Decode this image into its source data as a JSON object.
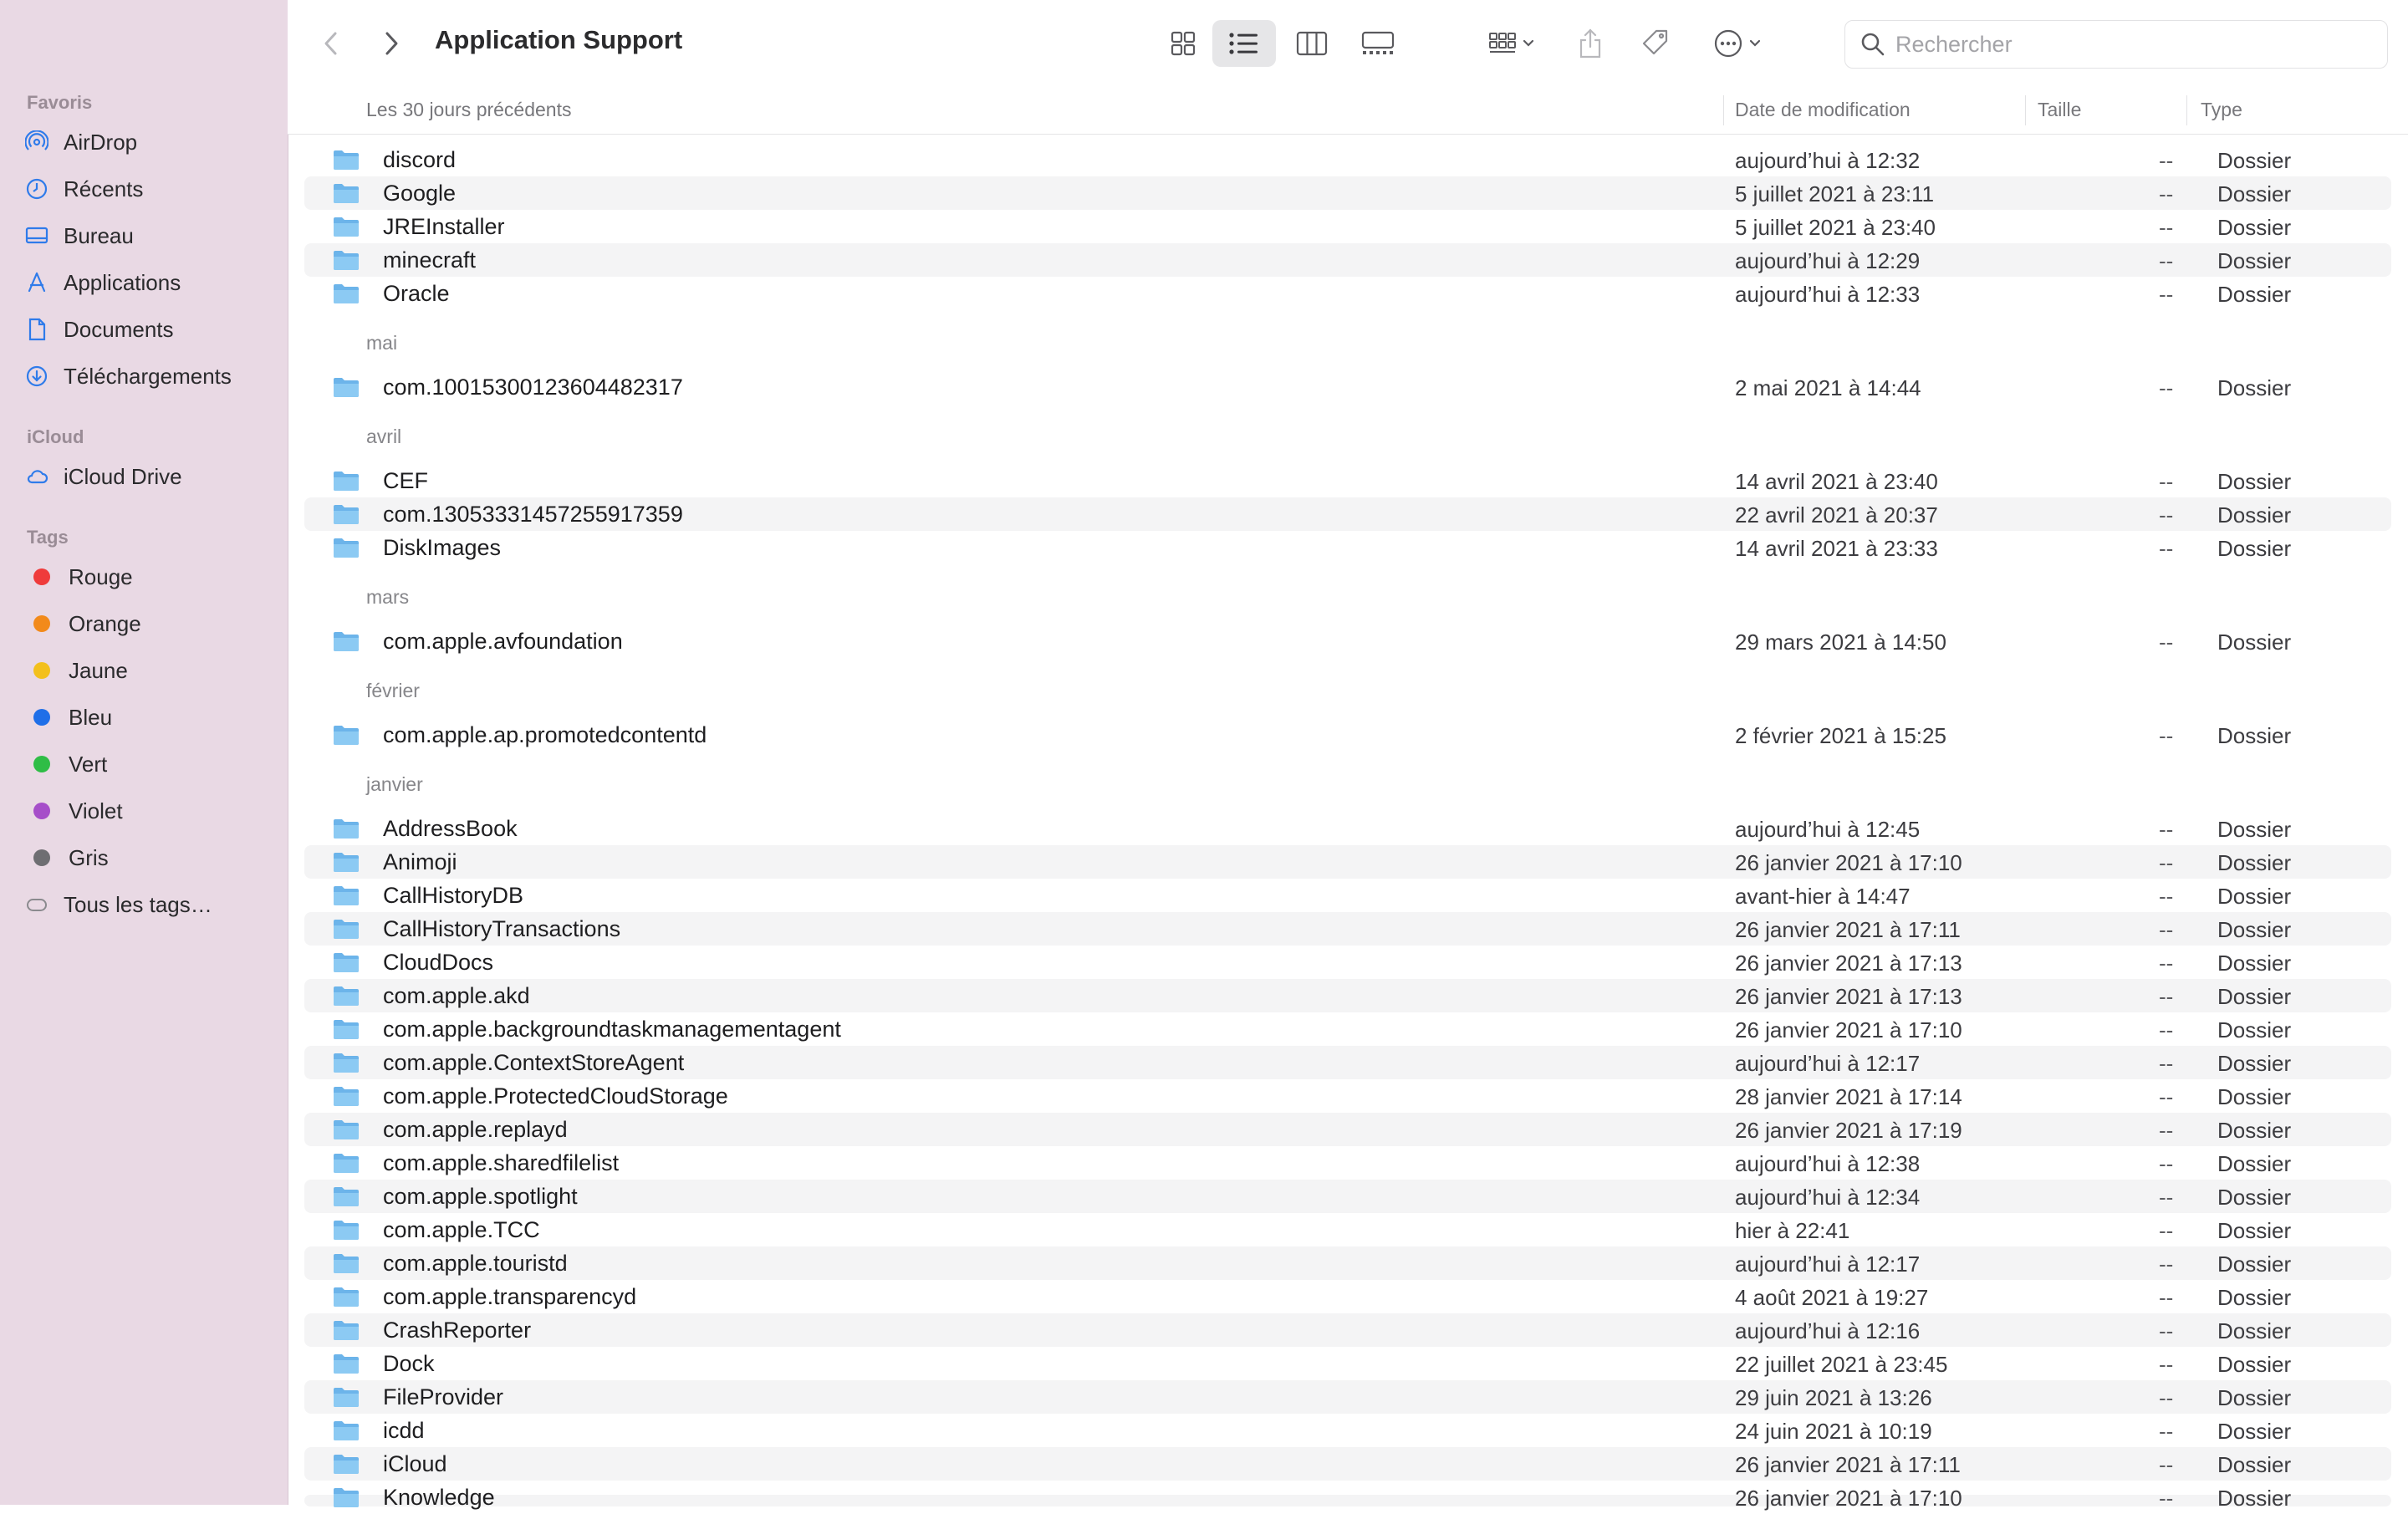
{
  "window": {
    "title": "Application Support"
  },
  "sidebar": {
    "favoris_label": "Favoris",
    "favoris": [
      {
        "label": "AirDrop",
        "icon": "airdrop-icon"
      },
      {
        "label": "Récents",
        "icon": "clock-icon"
      },
      {
        "label": "Bureau",
        "icon": "desktop-icon"
      },
      {
        "label": "Applications",
        "icon": "applications-icon"
      },
      {
        "label": "Documents",
        "icon": "document-icon"
      },
      {
        "label": "Téléchargements",
        "icon": "download-icon"
      }
    ],
    "icloud_label": "iCloud",
    "icloud": [
      {
        "label": "iCloud Drive",
        "icon": "cloud-icon"
      }
    ],
    "tags_label": "Tags",
    "tags": [
      {
        "label": "Rouge",
        "color": "#ef3b3b"
      },
      {
        "label": "Orange",
        "color": "#f28a1b"
      },
      {
        "label": "Jaune",
        "color": "#f3c01c"
      },
      {
        "label": "Bleu",
        "color": "#1f6fe8"
      },
      {
        "label": "Vert",
        "color": "#2fbd46"
      },
      {
        "label": "Violet",
        "color": "#a64ec9"
      },
      {
        "label": "Gris",
        "color": "#6e6e72"
      }
    ],
    "all_tags": "Tous les tags…"
  },
  "toolbar": {
    "search_placeholder": "Rechercher"
  },
  "columns": {
    "name": "Les 30 jours précédents",
    "date": "Date de modification",
    "size": "Taille",
    "type": "Type"
  },
  "groups": [
    {
      "label": "",
      "rows": [
        {
          "name": "discord",
          "date": "aujourd’hui à 12:32",
          "size": "--",
          "type": "Dossier"
        },
        {
          "name": "Google",
          "date": "5 juillet 2021 à 23:11",
          "size": "--",
          "type": "Dossier"
        },
        {
          "name": "JREInstaller",
          "date": "5 juillet 2021 à 23:40",
          "size": "--",
          "type": "Dossier"
        },
        {
          "name": "minecraft",
          "date": "aujourd’hui à 12:29",
          "size": "--",
          "type": "Dossier"
        },
        {
          "name": "Oracle",
          "date": "aujourd’hui à 12:33",
          "size": "--",
          "type": "Dossier"
        }
      ]
    },
    {
      "label": "mai",
      "rows": [
        {
          "name": "com.10015300123604482317",
          "date": "2 mai 2021 à 14:44",
          "size": "--",
          "type": "Dossier"
        }
      ]
    },
    {
      "label": "avril",
      "rows": [
        {
          "name": "CEF",
          "date": "14 avril 2021 à 23:40",
          "size": "--",
          "type": "Dossier"
        },
        {
          "name": "com.13053331457255917359",
          "date": "22 avril 2021 à 20:37",
          "size": "--",
          "type": "Dossier"
        },
        {
          "name": "DiskImages",
          "date": "14 avril 2021 à 23:33",
          "size": "--",
          "type": "Dossier"
        }
      ]
    },
    {
      "label": "mars",
      "rows": [
        {
          "name": "com.apple.avfoundation",
          "date": "29 mars 2021 à 14:50",
          "size": "--",
          "type": "Dossier"
        }
      ]
    },
    {
      "label": "février",
      "rows": [
        {
          "name": "com.apple.ap.promotedcontentd",
          "date": "2 février 2021 à 15:25",
          "size": "--",
          "type": "Dossier"
        }
      ]
    },
    {
      "label": "janvier",
      "rows": [
        {
          "name": "AddressBook",
          "date": "aujourd’hui à 12:45",
          "size": "--",
          "type": "Dossier"
        },
        {
          "name": "Animoji",
          "date": "26 janvier 2021 à 17:10",
          "size": "--",
          "type": "Dossier"
        },
        {
          "name": "CallHistoryDB",
          "date": "avant-hier à 14:47",
          "size": "--",
          "type": "Dossier"
        },
        {
          "name": "CallHistoryTransactions",
          "date": "26 janvier 2021 à 17:11",
          "size": "--",
          "type": "Dossier"
        },
        {
          "name": "CloudDocs",
          "date": "26 janvier 2021 à 17:13",
          "size": "--",
          "type": "Dossier"
        },
        {
          "name": "com.apple.akd",
          "date": "26 janvier 2021 à 17:13",
          "size": "--",
          "type": "Dossier"
        },
        {
          "name": "com.apple.backgroundtaskmanagementagent",
          "date": "26 janvier 2021 à 17:10",
          "size": "--",
          "type": "Dossier"
        },
        {
          "name": "com.apple.ContextStoreAgent",
          "date": "aujourd’hui à 12:17",
          "size": "--",
          "type": "Dossier"
        },
        {
          "name": "com.apple.ProtectedCloudStorage",
          "date": "28 janvier 2021 à 17:14",
          "size": "--",
          "type": "Dossier"
        },
        {
          "name": "com.apple.replayd",
          "date": "26 janvier 2021 à 17:19",
          "size": "--",
          "type": "Dossier"
        },
        {
          "name": "com.apple.sharedfilelist",
          "date": "aujourd’hui à 12:38",
          "size": "--",
          "type": "Dossier"
        },
        {
          "name": "com.apple.spotlight",
          "date": "aujourd’hui à 12:34",
          "size": "--",
          "type": "Dossier"
        },
        {
          "name": "com.apple.TCC",
          "date": "hier à 22:41",
          "size": "--",
          "type": "Dossier"
        },
        {
          "name": "com.apple.touristd",
          "date": "aujourd’hui à 12:17",
          "size": "--",
          "type": "Dossier"
        },
        {
          "name": "com.apple.transparencyd",
          "date": "4 août 2021 à 19:27",
          "size": "--",
          "type": "Dossier"
        },
        {
          "name": "CrashReporter",
          "date": "aujourd’hui à 12:16",
          "size": "--",
          "type": "Dossier"
        },
        {
          "name": "Dock",
          "date": "22 juillet 2021 à 23:45",
          "size": "--",
          "type": "Dossier"
        },
        {
          "name": "FileProvider",
          "date": "29 juin 2021 à 13:26",
          "size": "--",
          "type": "Dossier"
        },
        {
          "name": "icdd",
          "date": "24 juin 2021 à 10:19",
          "size": "--",
          "type": "Dossier"
        },
        {
          "name": "iCloud",
          "date": "26 janvier 2021 à 17:11",
          "size": "--",
          "type": "Dossier"
        },
        {
          "name": "Knowledge",
          "date": "26 janvier 2021 à 17:10",
          "size": "--",
          "type": "Dossier"
        }
      ]
    }
  ],
  "colors": {
    "folder": "#6cb4ea",
    "accent": "#1f6fe8",
    "sidebar_bg": "#e9d9e4"
  }
}
